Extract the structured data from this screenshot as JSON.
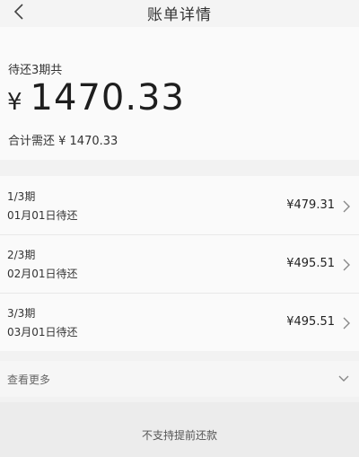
{
  "header": {
    "title": "账单详情",
    "back_icon": "chevron-left-icon"
  },
  "summary": {
    "pending_label": "待还3期共",
    "currency": "¥",
    "amount": "1470.33",
    "total_label": "合计需还 ¥ 1470.33"
  },
  "installments": [
    {
      "period": "1/3期",
      "due": "01月01日待还",
      "amount": "¥479.31"
    },
    {
      "period": "2/3期",
      "due": "02月01日待还",
      "amount": "¥495.51"
    },
    {
      "period": "3/3期",
      "due": "03月01日待还",
      "amount": "¥495.51"
    }
  ],
  "more": {
    "label": "查看更多",
    "icon": "chevron-down-icon"
  },
  "footer": {
    "label": "不支持提前还款"
  }
}
